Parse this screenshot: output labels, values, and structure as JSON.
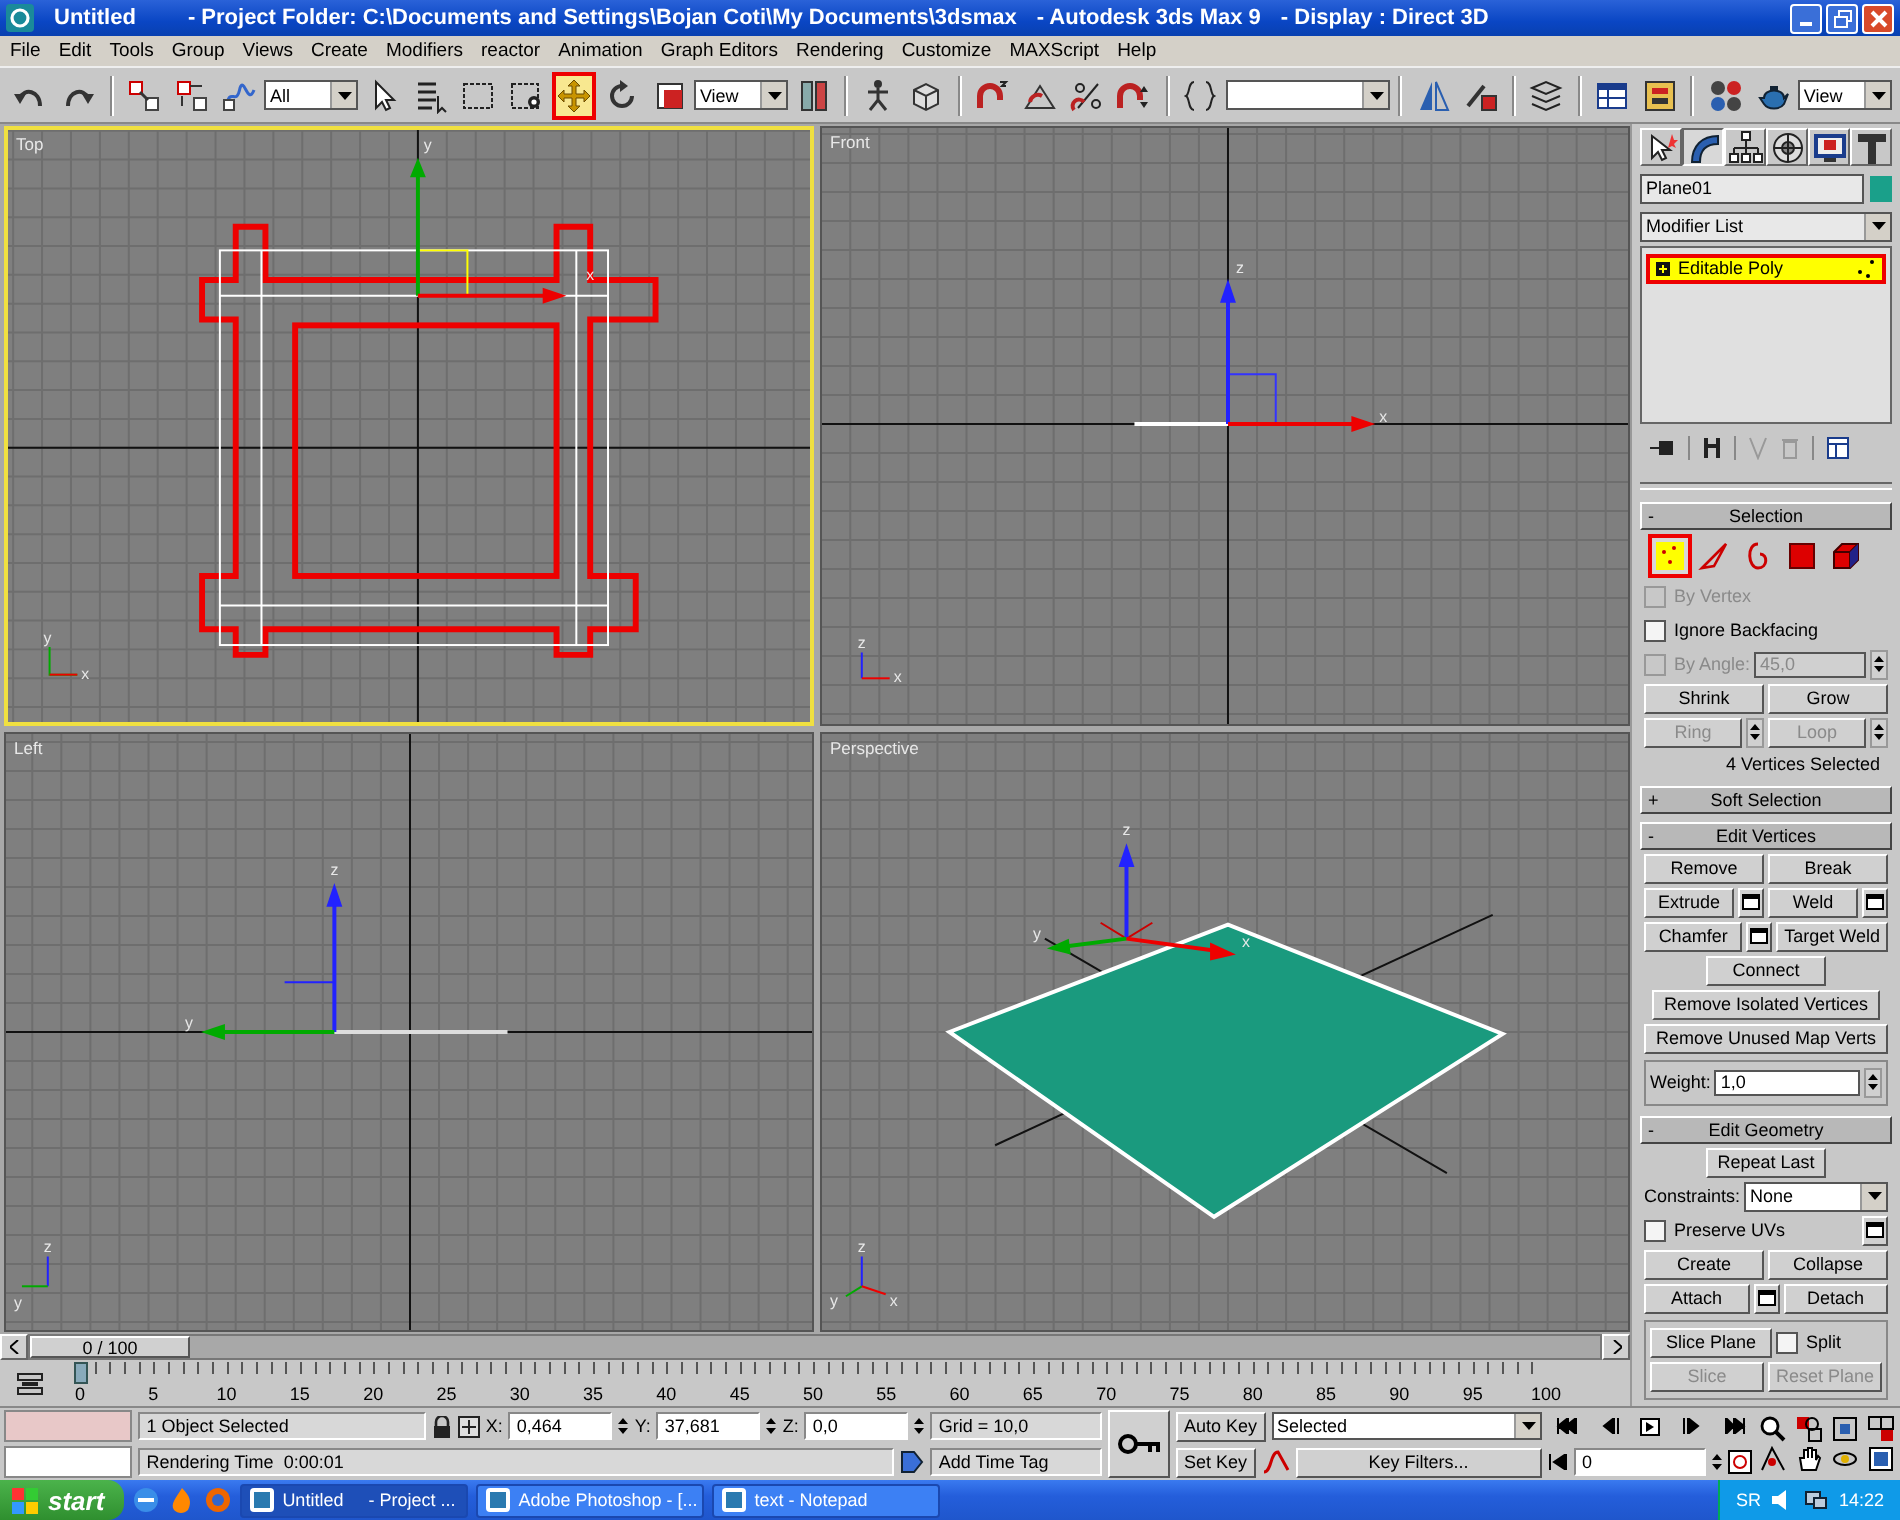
{
  "window": {
    "title_parts": [
      "Untitled",
      "- Project Folder: C:\\Documents and Settings\\Bojan Coti\\My Documents\\3dsmax",
      "- Autodesk 3ds Max 9",
      "- Display : Direct 3D"
    ]
  },
  "menu": [
    "File",
    "Edit",
    "Tools",
    "Group",
    "Views",
    "Create",
    "Modifiers",
    "reactor",
    "Animation",
    "Graph Editors",
    "Rendering",
    "Customize",
    "MAXScript",
    "Help"
  ],
  "toolbar": [
    {
      "kind": "tool",
      "selected": false,
      "annotated": false
    },
    {
      "kind": "tool",
      "selected": false,
      "annotated": false
    },
    {
      "kind": "separator"
    },
    {
      "kind": "tool",
      "selected": false,
      "annotated": false
    },
    {
      "kind": "tool",
      "selected": false,
      "annotated": false
    },
    {
      "kind": "tool",
      "selected": false,
      "annotated": false
    },
    {
      "kind": "dropdown",
      "value": "All"
    },
    {
      "kind": "tool",
      "selected": false,
      "annotated": false
    },
    {
      "kind": "tool",
      "selected": false,
      "annotated": false
    },
    {
      "kind": "tool",
      "selected": false,
      "annotated": false
    },
    {
      "kind": "tool",
      "selected": false,
      "annotated": false
    },
    {
      "kind": "tool",
      "selected": true,
      "annotated": true
    },
    {
      "kind": "tool",
      "selected": false,
      "annotated": false
    },
    {
      "kind": "tool",
      "selected": false,
      "annotated": false
    },
    {
      "kind": "dropdown",
      "value": "View"
    },
    {
      "kind": "tool",
      "selected": false,
      "annotated": false
    },
    {
      "kind": "separator"
    },
    {
      "kind": "tool",
      "selected": false,
      "annotated": false
    },
    {
      "kind": "tool",
      "selected": false,
      "annotated": false
    },
    {
      "kind": "separator"
    },
    {
      "kind": "tool",
      "selected": false,
      "annotated": false
    },
    {
      "kind": "tool",
      "selected": false,
      "annotated": false
    },
    {
      "kind": "tool",
      "selected": false,
      "annotated": false
    },
    {
      "kind": "tool",
      "selected": false,
      "annotated": false
    },
    {
      "kind": "separator"
    },
    {
      "kind": "tool",
      "selected": false,
      "annotated": false
    },
    {
      "kind": "dropdown"
    },
    {
      "kind": "separator"
    },
    {
      "kind": "tool",
      "selected": false,
      "annotated": false
    },
    {
      "kind": "tool",
      "selected": false,
      "annotated": false
    },
    {
      "kind": "separator"
    },
    {
      "kind": "tool",
      "selected": false,
      "annotated": false
    },
    {
      "kind": "separator"
    },
    {
      "kind": "tool",
      "selected": false,
      "annotated": false
    },
    {
      "kind": "tool",
      "selected": false,
      "annotated": false
    },
    {
      "kind": "separator"
    },
    {
      "kind": "tool",
      "selected": false,
      "annotated": false
    },
    {
      "kind": "tool",
      "selected": false,
      "annotated": false
    },
    {
      "kind": "dropdown",
      "value": "View"
    }
  ],
  "viewports": [
    {
      "label": "Top",
      "kind": "top",
      "selected": true,
      "gizmo_labels": [
        "y",
        "x"
      ],
      "tripod_labels": [
        "y",
        "x"
      ]
    },
    {
      "label": "Front",
      "kind": "front",
      "selected": false,
      "gizmo_labels": [
        "z",
        "x"
      ],
      "tripod_labels": [
        "z",
        "x"
      ]
    },
    {
      "label": "Left",
      "kind": "left",
      "selected": false,
      "gizmo_labels": [
        "z",
        "y"
      ],
      "tripod_labels": [
        "z",
        "y"
      ]
    },
    {
      "label": "Perspective",
      "kind": "perspective",
      "selected": false,
      "gizmo_labels": [
        "z",
        "y",
        "x"
      ],
      "tripod_labels": [
        "z",
        "y",
        "x"
      ]
    }
  ],
  "time_slider": {
    "label": "0 / 100",
    "level": 0
  },
  "ruler_labels": [
    "0",
    "5",
    "10",
    "15",
    "20",
    "25",
    "30",
    "35",
    "40",
    "45",
    "50",
    "55",
    "60",
    "65",
    "70",
    "75",
    "80",
    "85",
    "90",
    "95",
    "100"
  ],
  "command_panel": {
    "tabs": [
      {
        "selected": false
      },
      {
        "selected": true
      },
      {
        "selected": false
      },
      {
        "selected": false
      },
      {
        "selected": false
      },
      {
        "selected": false
      }
    ],
    "object_name": "Plane01",
    "modifier_list": "Modifier List",
    "stack": [
      {
        "label": "Editable Poly",
        "selected": true,
        "annotated": true
      }
    ],
    "rollouts": [
      {
        "sign": "-",
        "title": "Selection",
        "rows": [
          {
            "kind": "subobjects",
            "items": [
              {
                "selected": true,
                "annotated": true
              },
              {
                "selected": false,
                "annotated": false
              },
              {
                "selected": false,
                "annotated": false
              },
              {
                "selected": false,
                "annotated": false
              },
              {
                "selected": false,
                "annotated": false
              }
            ]
          },
          {
            "kind": "row",
            "items": [
              {
                "kind": "checkbox",
                "label": "By Vertex",
                "checked": false,
                "disabled": true
              }
            ]
          },
          {
            "kind": "row",
            "items": [
              {
                "kind": "checkbox",
                "label": "Ignore Backfacing",
                "checked": false,
                "disabled": false
              }
            ]
          },
          {
            "kind": "row",
            "items": [
              {
                "kind": "checkbox",
                "label": "By Angle:",
                "checked": false,
                "disabled": true
              },
              {
                "kind": "spinner",
                "value": "45,0",
                "disabled": true
              }
            ]
          },
          {
            "kind": "row",
            "items": [
              {
                "kind": "button",
                "label": "Shrink",
                "disabled": false
              },
              {
                "kind": "button",
                "label": "Grow",
                "disabled": false
              }
            ]
          },
          {
            "kind": "row",
            "items": [
              {
                "kind": "button",
                "label": "Ring",
                "disabled": true
              },
              {
                "kind": "spin"
              },
              {
                "kind": "button",
                "label": "Loop",
                "disabled": true
              },
              {
                "kind": "spin"
              }
            ]
          },
          {
            "kind": "status",
            "text": "4 Vertices Selected"
          }
        ]
      },
      {
        "sign": "+",
        "title": "Soft Selection"
      },
      {
        "sign": "-",
        "title": "Edit Vertices",
        "rows": [
          {
            "kind": "row",
            "items": [
              {
                "kind": "button",
                "label": "Remove",
                "disabled": false
              },
              {
                "kind": "button",
                "label": "Break",
                "disabled": false
              }
            ]
          },
          {
            "kind": "row",
            "items": [
              {
                "kind": "button",
                "label": "Extrude",
                "disabled": false
              },
              {
                "kind": "settings"
              },
              {
                "kind": "button",
                "label": "Weld",
                "disabled": false
              },
              {
                "kind": "settings"
              }
            ]
          },
          {
            "kind": "row",
            "items": [
              {
                "kind": "button",
                "label": "Chamfer",
                "disabled": false
              },
              {
                "kind": "settings"
              },
              {
                "kind": "button",
                "label": "Target Weld",
                "disabled": false
              }
            ]
          },
          {
            "kind": "single",
            "items": [
              {
                "kind": "button",
                "label": "Connect",
                "disabled": false
              }
            ]
          },
          {
            "kind": "single",
            "items": [
              {
                "kind": "button",
                "label": "Remove Isolated Vertices",
                "disabled": false
              }
            ]
          },
          {
            "kind": "single",
            "items": [
              {
                "kind": "button",
                "label": "Remove Unused Map Verts",
                "disabled": false
              }
            ]
          },
          {
            "kind": "group",
            "rows": [
              {
                "items": [
                  {
                    "kind": "spinner",
                    "label": "Weight:",
                    "value": "1,0",
                    "disabled": false
                  }
                ]
              }
            ]
          }
        ]
      },
      {
        "sign": "-",
        "title": "Edit Geometry",
        "rows": [
          {
            "kind": "single",
            "items": [
              {
                "kind": "button",
                "label": "Repeat Last",
                "disabled": false
              }
            ]
          },
          {
            "kind": "row",
            "items": [
              {
                "kind": "dropdown",
                "label": "Constraints:",
                "value": "None"
              }
            ]
          },
          {
            "kind": "row",
            "items": [
              {
                "kind": "checkbox",
                "label": "Preserve UVs",
                "checked": false,
                "disabled": false
              },
              {
                "kind": "settings"
              }
            ]
          },
          {
            "kind": "row",
            "items": [
              {
                "kind": "button",
                "label": "Create",
                "disabled": false
              },
              {
                "kind": "button",
                "label": "Collapse",
                "disabled": false
              }
            ]
          },
          {
            "kind": "row",
            "items": [
              {
                "kind": "button",
                "label": "Attach",
                "disabled": false
              },
              {
                "kind": "settings"
              },
              {
                "kind": "button",
                "label": "Detach",
                "disabled": false
              }
            ]
          },
          {
            "kind": "group",
            "rows": [
              {
                "items": [
                  {
                    "kind": "button",
                    "label": "Slice Plane",
                    "disabled": false
                  },
                  {
                    "kind": "checkbox",
                    "label": "Split",
                    "checked": false,
                    "disabled": false
                  }
                ]
              },
              {
                "items": [
                  {
                    "kind": "button",
                    "label": "Slice",
                    "disabled": true
                  },
                  {
                    "kind": "button",
                    "label": "Reset Plane",
                    "disabled": true
                  }
                ]
              }
            ]
          }
        ]
      }
    ]
  },
  "status_bar": {
    "selection": "1 Object Selected",
    "render_time": "Rendering Time  0:00:01",
    "coords": [
      {
        "label": "X:",
        "value": "0,464"
      },
      {
        "label": "Y:",
        "value": "37,681"
      },
      {
        "label": "Z:",
        "value": "0,0"
      }
    ],
    "grid": "Grid = 10,0",
    "time_tag": "Add Time Tag",
    "auto_key": "Auto Key",
    "key_mode": "Selected",
    "set_key": "Set Key",
    "key_filters": "Key Filters...",
    "frame": "0"
  },
  "taskbar": {
    "start": "start",
    "tasks": [
      {
        "label": "Untitled     - Project ...",
        "selected": true
      },
      {
        "label": "Adobe Photoshop - [...",
        "selected": false
      },
      {
        "label": "text - Notepad",
        "selected": false
      }
    ],
    "language": "SR",
    "clock": "14:22"
  }
}
